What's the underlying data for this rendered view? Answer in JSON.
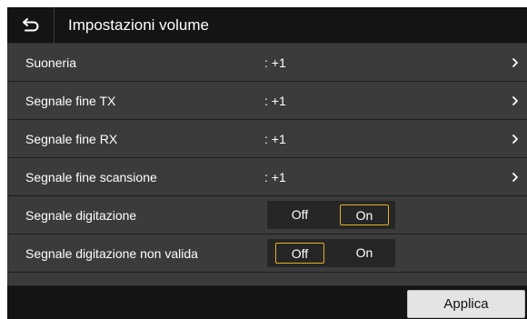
{
  "header": {
    "back_icon": "back-arrow-icon",
    "title": "Impostazioni volume"
  },
  "settings": [
    {
      "label": "Suoneria",
      "value": ": +1"
    },
    {
      "label": "Segnale fine TX",
      "value": ": +1"
    },
    {
      "label": "Segnale fine RX",
      "value": ": +1"
    },
    {
      "label": "Segnale fine scansione",
      "value": ": +1"
    }
  ],
  "toggles": [
    {
      "label": "Segnale digitazione",
      "off_label": "Off",
      "on_label": "On",
      "selected": "On"
    },
    {
      "label": "Segnale digitazione non valida",
      "off_label": "Off",
      "on_label": "On",
      "selected": "Off"
    }
  ],
  "footer": {
    "apply_label": "Applica"
  },
  "colors": {
    "background": "#1c1c1c",
    "row": "#3b3b3b",
    "selection_border": "#e3b020",
    "button": "#e4e4e4"
  }
}
